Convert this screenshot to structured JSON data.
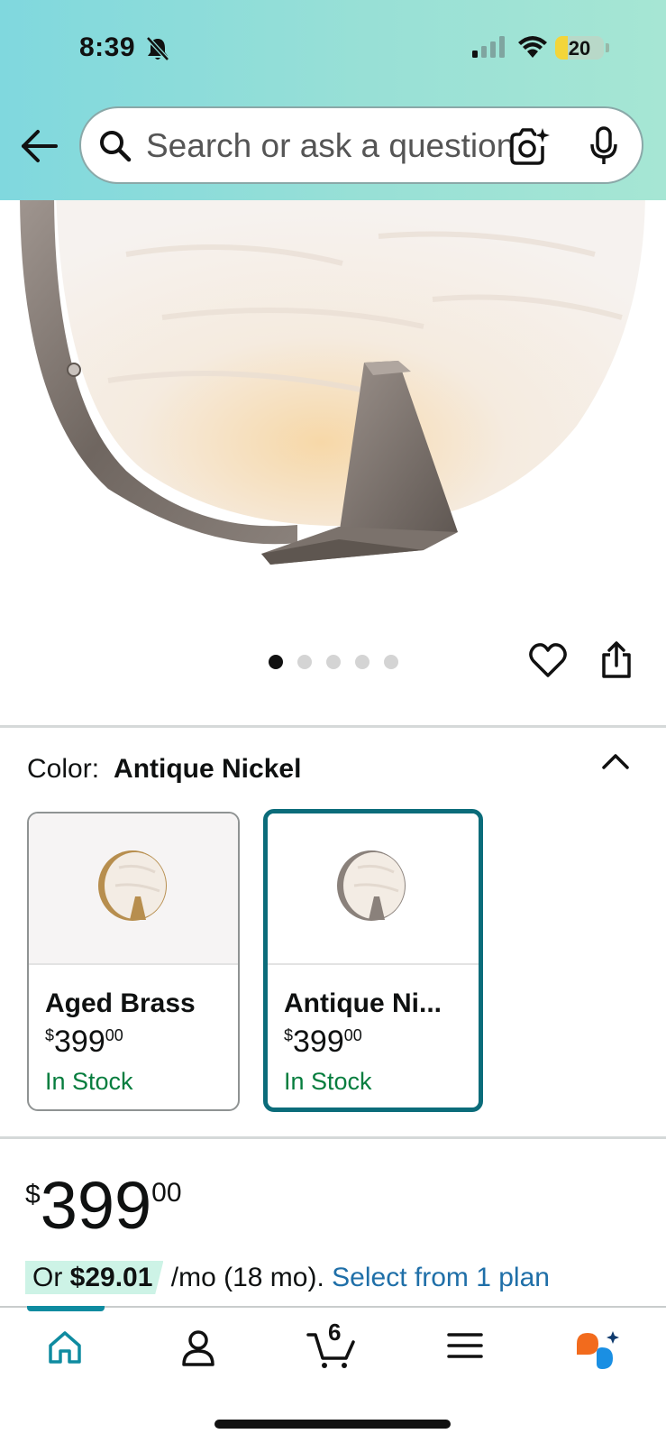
{
  "status_bar": {
    "time": "8:39",
    "battery": "20"
  },
  "header": {
    "search_placeholder": "Search or ask a question"
  },
  "gallery": {
    "image_count": 5,
    "active_index": 0
  },
  "color": {
    "label": "Color:",
    "selected": "Antique Nickel"
  },
  "variants": [
    {
      "name": "Aged Brass",
      "currency": "$",
      "price_whole": "399",
      "price_fraction": "00",
      "stock": "In Stock"
    },
    {
      "name": "Antique Ni...",
      "currency": "$",
      "price_whole": "399",
      "price_fraction": "00",
      "stock": "In Stock"
    }
  ],
  "price": {
    "currency": "$",
    "whole": "399",
    "fraction": "00"
  },
  "installment": {
    "prefix": "Or ",
    "amount": "$29.01",
    "terms": " /mo (18 mo). ",
    "link": "Select from 1 plan"
  },
  "bottom_nav": {
    "cart_count": "6"
  },
  "colors": {
    "accent_teal": "#0b6c7a",
    "stock_green": "#067d3e",
    "link_blue": "#1f6fa8"
  }
}
